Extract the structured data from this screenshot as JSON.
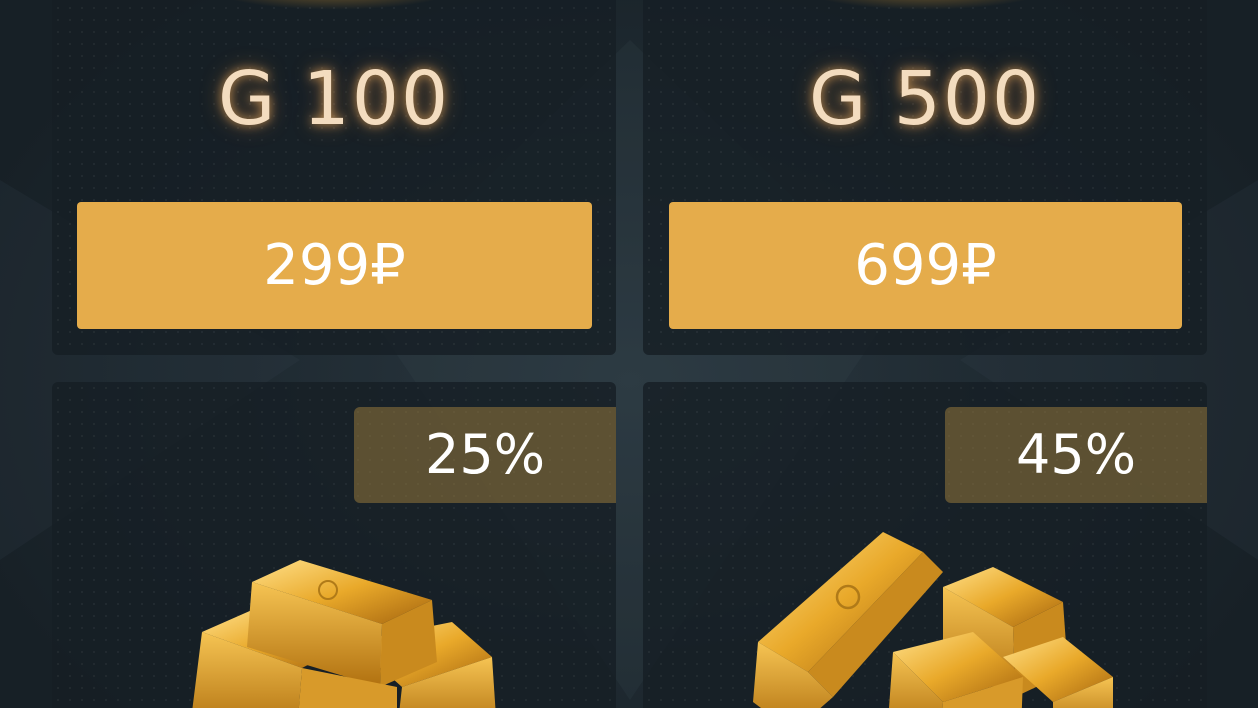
{
  "packs": [
    {
      "amount": "G 100",
      "price": "299₽"
    },
    {
      "amount": "G 500",
      "price": "699₽"
    }
  ],
  "bonus_packs": [
    {
      "discount": "25%",
      "icon": "gold-bars-small-icon"
    },
    {
      "discount": "45%",
      "icon": "gold-bars-large-icon"
    }
  ],
  "colors": {
    "button": "#e5ac4b",
    "amount_text": "#f3dcbf",
    "background": "#1f2a32",
    "card": "#161e24",
    "badge": "#96783c"
  }
}
